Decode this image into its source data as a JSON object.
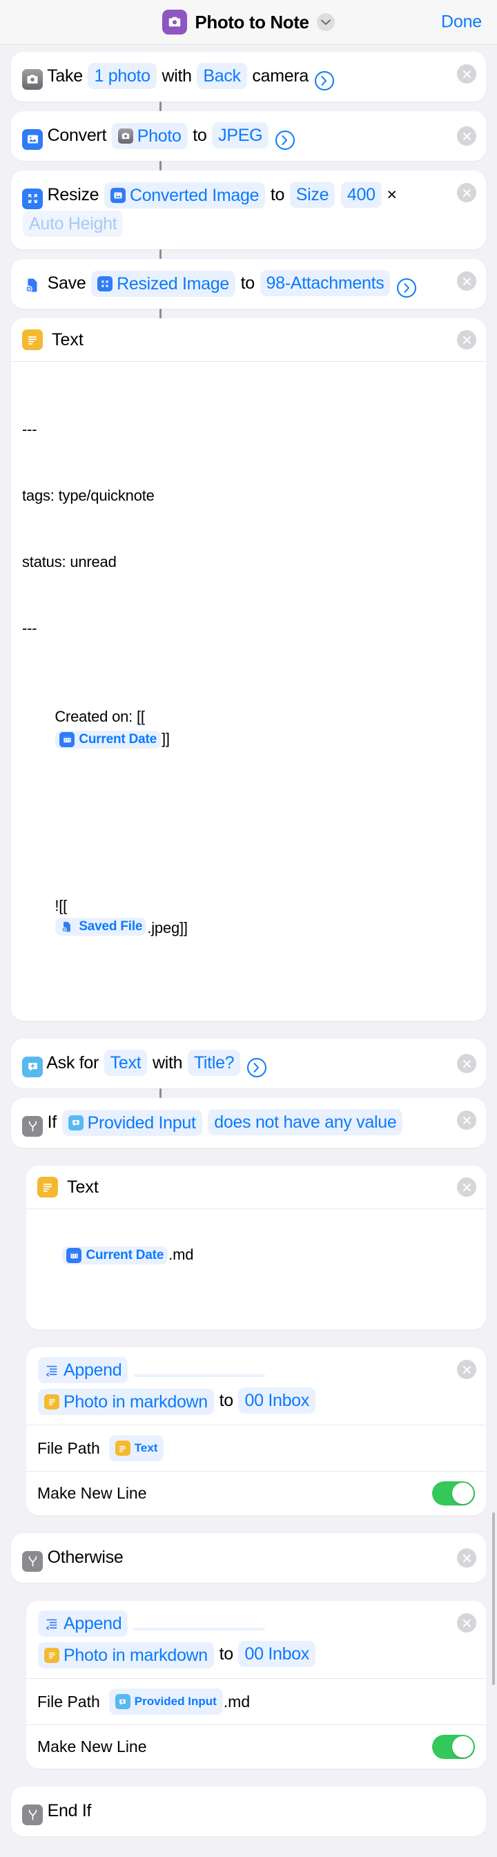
{
  "nav": {
    "title": "Photo to Note",
    "done_label": "Done",
    "app_icon": "camera-icon",
    "chevron": "chevron-down-icon"
  },
  "actions": [
    {
      "id": "take-photo",
      "icon": "camera-icon",
      "verb": "Take",
      "tokens": [
        "1 photo"
      ],
      "word_with": "with",
      "camera": "Back",
      "tail": "camera",
      "chevron": "chevron-right-icon",
      "close": "close-icon"
    },
    {
      "id": "convert-image",
      "icon": "image-icon",
      "verb": "Convert",
      "variable": "Photo",
      "variable_icon": "camera-icon",
      "word_to": "to",
      "format": "JPEG",
      "chevron": "chevron-right-icon",
      "close": "close-icon"
    },
    {
      "id": "resize-image",
      "icon": "resize-icon",
      "verb": "Resize",
      "variable": "Converted Image",
      "variable_icon": "image-icon",
      "word_to": "to",
      "dimension_label": "Size",
      "width": "400",
      "times": "×",
      "height_placeholder": "Auto Height",
      "close": "close-icon"
    },
    {
      "id": "save-file",
      "icon": "save-file-icon",
      "verb": "Save",
      "variable": "Resized Image",
      "variable_icon": "resize-icon",
      "word_to": "to",
      "destination": "98-Attachments",
      "chevron": "chevron-right-icon",
      "close": "close-icon"
    },
    {
      "id": "text-block-1",
      "icon": "text-icon",
      "title": "Text",
      "close": "close-icon",
      "body_lines": [
        "---",
        "tags: type/quicknote",
        "status: unread",
        "---"
      ],
      "created_prefix": "Created on: [[",
      "created_token": "Current Date",
      "created_token_icon": "calendar-icon",
      "created_suffix": "]]",
      "image_prefix": "![[",
      "image_token": "Saved File",
      "image_token_icon": "save-file-icon",
      "image_suffix": ".jpeg]]"
    },
    {
      "id": "ask-for-input",
      "icon": "ask-input-icon",
      "verb": "Ask for",
      "type": "Text",
      "word_with": "with",
      "prompt": "Title?",
      "chevron": "chevron-right-icon",
      "close": "close-icon"
    },
    {
      "id": "if-condition",
      "icon": "if-icon",
      "verb": "If",
      "variable": "Provided Input",
      "variable_icon": "ask-input-icon",
      "condition": "does not have any value",
      "close": "close-icon"
    },
    {
      "id": "text-block-2",
      "icon": "text-icon",
      "title": "Text",
      "close": "close-icon",
      "token": "Current Date",
      "token_icon": "calendar-icon",
      "suffix": ".md"
    },
    {
      "id": "append-1",
      "icon": "append-icon",
      "verb": "Append",
      "blank_field": "",
      "content": "Photo in markdown",
      "content_icon": "text-icon",
      "word_to": "to",
      "destination": "00 Inbox",
      "close": "close-icon",
      "params": [
        {
          "label": "File Path",
          "value": "Text",
          "value_icon": "text-icon",
          "value_suffix": "",
          "type": "token"
        },
        {
          "label": "Make New Line",
          "value": "on",
          "type": "toggle"
        }
      ]
    },
    {
      "id": "otherwise",
      "icon": "if-icon",
      "verb": "Otherwise",
      "close": "close-icon"
    },
    {
      "id": "append-2",
      "icon": "append-icon",
      "verb": "Append",
      "blank_field": "",
      "content": "Photo in markdown",
      "content_icon": "text-icon",
      "word_to": "to",
      "destination": "00 Inbox",
      "close": "close-icon",
      "params": [
        {
          "label": "File Path",
          "value": "Provided Input",
          "value_icon": "ask-input-icon",
          "value_suffix": ".md",
          "type": "token"
        },
        {
          "label": "Make New Line",
          "value": "on",
          "type": "toggle"
        }
      ]
    },
    {
      "id": "end-if",
      "icon": "if-icon",
      "verb": "End If",
      "close": "close-icon"
    }
  ],
  "colors": {
    "accent_blue": "#0a7aff",
    "token_bg": "#eaf1fe",
    "app_purple": "#8e55c4",
    "toggle_green": "#34c759",
    "canvas_bg": "#f2f1f6",
    "card_bg": "#ffffff"
  }
}
